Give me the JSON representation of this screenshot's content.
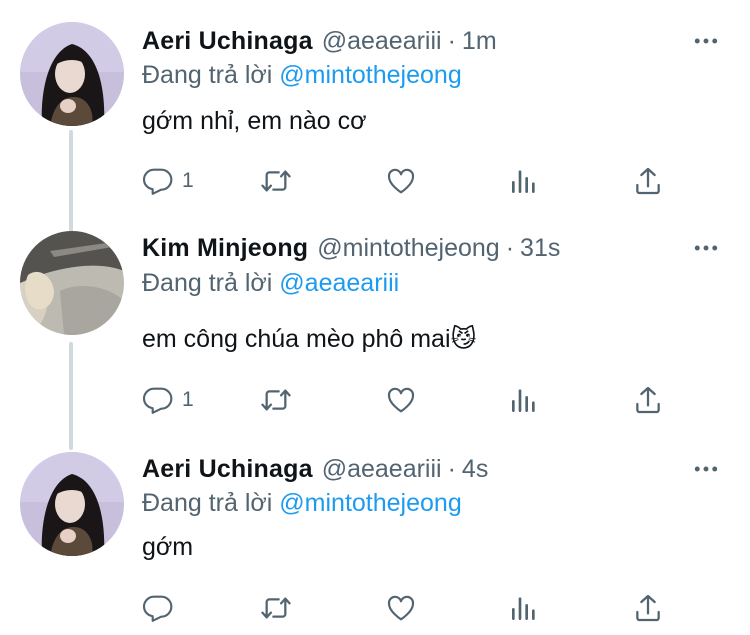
{
  "thread": {
    "tweets": [
      {
        "name": "Aeri Uchinaga",
        "handle": "@aeaeariii",
        "separator": "·",
        "time": "1m",
        "replying_prefix": "Đang trả lời",
        "replying_to": "@mintothejeong",
        "text": "gớm nhỉ, em nào cơ",
        "emoji": "",
        "reply_count": "1",
        "avatar_icon": "avatar-aeri"
      },
      {
        "name": "Kim Minjeong",
        "handle": "@mintothejeong",
        "separator": "·",
        "time": "31s",
        "replying_prefix": "Đang trả lời",
        "replying_to": "@aeaeariii",
        "text": "em công chúa mèo phô mai",
        "emoji": "😼",
        "reply_count": "1",
        "avatar_icon": "avatar-minjeong"
      },
      {
        "name": "Aeri Uchinaga",
        "handle": "@aeaeariii",
        "separator": "·",
        "time": "4s",
        "replying_prefix": "Đang trả lời",
        "replying_to": "@mintothejeong",
        "text": "gớm",
        "emoji": "",
        "reply_count": "",
        "avatar_icon": "avatar-aeri"
      }
    ]
  },
  "colors": {
    "text_primary": "#0f1419",
    "text_secondary": "#536471",
    "accent": "#1d9bf0",
    "thread_line": "#cfd9de"
  },
  "icons": [
    "more-icon",
    "reply-icon",
    "retweet-icon",
    "like-icon",
    "views-icon",
    "share-icon"
  ]
}
